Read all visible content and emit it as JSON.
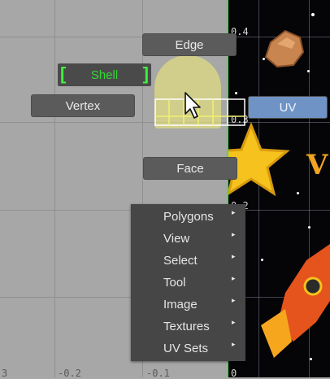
{
  "marking_menu": {
    "edge": "Edge",
    "shell": "Shell",
    "vertex": "Vertex",
    "uv": "UV",
    "face": "Face"
  },
  "context_menu": {
    "items": [
      {
        "label": "Polygons"
      },
      {
        "label": "View"
      },
      {
        "label": "Select"
      },
      {
        "label": "Tool"
      },
      {
        "label": "Image"
      },
      {
        "label": "Textures"
      },
      {
        "label": "UV Sets"
      }
    ]
  },
  "axis_labels": {
    "top_right": "0.4",
    "mid_right": "0.3",
    "lower_right": "0.2",
    "bottom_left": "3",
    "bottom_mid": "-0.2",
    "bottom_mid2": "-0.1",
    "bottom_right": "0"
  },
  "texture": {
    "title_fragment": "V",
    "colors": {
      "star": "#f6c21d",
      "rock": "#c98550",
      "rocket": "#e5541c"
    }
  }
}
